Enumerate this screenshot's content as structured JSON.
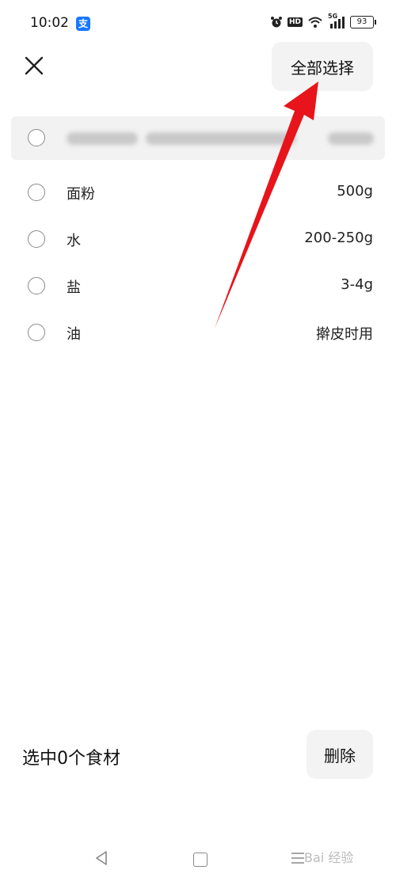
{
  "status_bar": {
    "time": "10:02",
    "app_icon": "alipay-icon",
    "alipay_glyph": "支",
    "network_label": "HD",
    "network_type": "5G",
    "battery": "93"
  },
  "header": {
    "close_icon": "close-icon",
    "select_all_label": "全部选择"
  },
  "ingredients": [
    {
      "name": "面粉",
      "amount": "500g",
      "selected": false
    },
    {
      "name": "水",
      "amount": "200-250g",
      "selected": false
    },
    {
      "name": "盐",
      "amount": "3-4g",
      "selected": false
    },
    {
      "name": "油",
      "amount": "擀皮时用",
      "selected": false
    }
  ],
  "footer": {
    "selected_text": "选中0个食材",
    "delete_label": "删除"
  },
  "watermark": "Bai 经验",
  "colors": {
    "button_bg": "#f3f3f3",
    "annotation_arrow": "#e8141b",
    "alipay_blue": "#1677ff"
  }
}
